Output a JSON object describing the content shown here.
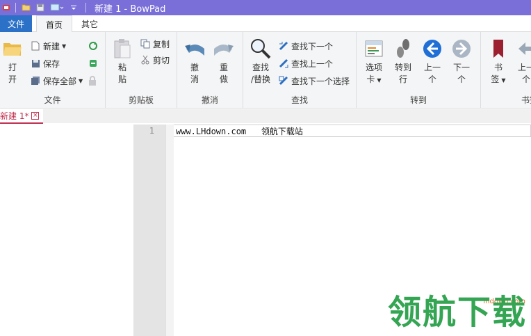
{
  "titlebar": {
    "title": "新建 1 - BowPad"
  },
  "tabs": {
    "file": "文件",
    "home": "首页",
    "other": "其它"
  },
  "ribbon": {
    "file_group": {
      "label": "文件",
      "open": [
        "打",
        "开"
      ],
      "new": "新建",
      "save": "保存",
      "save_all": "保存全部"
    },
    "clipboard_group": {
      "label": "剪贴板",
      "paste": [
        "粘",
        "贴"
      ],
      "copy": "复制",
      "cut": "剪切"
    },
    "undo_group": {
      "label": "撤消",
      "undo": [
        "撤",
        "消"
      ],
      "redo": [
        "重",
        "做"
      ]
    },
    "find_group": {
      "label": "查找",
      "find_replace": [
        "查找",
        "/替换"
      ],
      "find_next": "查找下一个",
      "find_prev": "查找上一个",
      "find_next_select": "查找下一个选择"
    },
    "goto_group": {
      "label": "转到",
      "tabs": [
        "选项",
        "卡"
      ],
      "goto_line": [
        "转到",
        "行"
      ],
      "prev": [
        "上一",
        "个"
      ],
      "next": [
        "下一",
        "个"
      ]
    },
    "bookmark_group": {
      "label": "书签",
      "bookmark": [
        "书",
        "签"
      ],
      "prev": [
        "上一",
        "个"
      ]
    }
  },
  "doc_tab": {
    "label": "新建 1*",
    "close": "×"
  },
  "editor": {
    "line_number": "1",
    "line_text": "www.LHdown.com   领航下载站"
  },
  "watermark": {
    "main": "领航下载",
    "url": "lhdown.com"
  },
  "colors": {
    "titlebar": "#7a6fd8",
    "file_tab": "#2b71c7",
    "doc_tab_accent": "#c0314f",
    "watermark": "#2aa14a"
  }
}
